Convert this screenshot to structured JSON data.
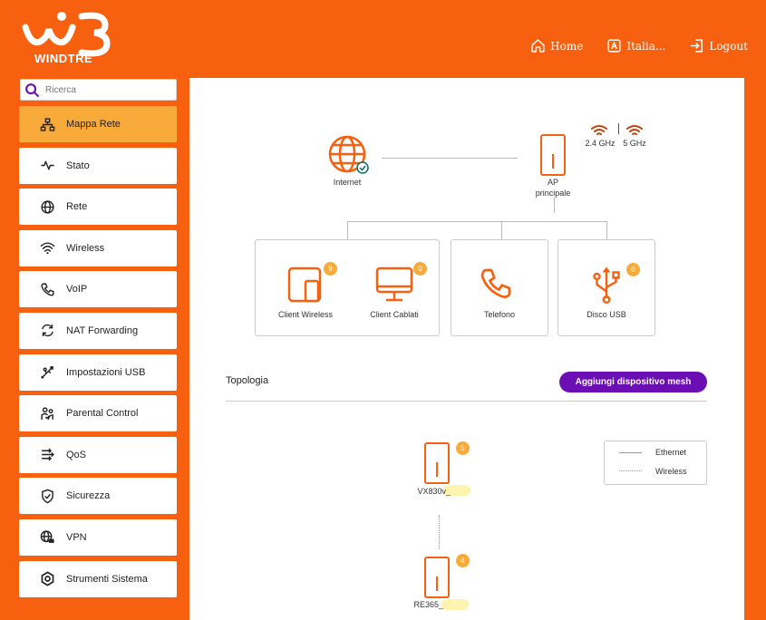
{
  "brand": {
    "name": "WINDTRE",
    "color": "#f6600f",
    "accent": "#f8aa3b",
    "purple": "#6b0fb4"
  },
  "topnav": [
    {
      "label": "Home",
      "icon": "home-icon"
    },
    {
      "label": "Italia...",
      "icon": "language-icon"
    },
    {
      "label": "Logout",
      "icon": "logout-icon"
    }
  ],
  "search": {
    "placeholder": "Ricerca"
  },
  "sidebar": {
    "items": [
      {
        "label": "Mappa Rete",
        "icon": "network-map-icon",
        "active": true
      },
      {
        "label": "Stato",
        "icon": "pulse-icon"
      },
      {
        "label": "Rete",
        "icon": "globe-icon"
      },
      {
        "label": "Wireless",
        "icon": "wifi-icon"
      },
      {
        "label": "VoIP",
        "icon": "phone-icon"
      },
      {
        "label": "NAT Forwarding",
        "icon": "refresh-icon"
      },
      {
        "label": "Impostazioni USB",
        "icon": "usb-icon"
      },
      {
        "label": "Parental Control",
        "icon": "family-icon"
      },
      {
        "label": "QoS",
        "icon": "qos-icon"
      },
      {
        "label": "Sicurezza",
        "icon": "shield-icon"
      },
      {
        "label": "VPN",
        "icon": "vpn-icon"
      },
      {
        "label": "Strumenti Sistema",
        "icon": "tools-icon"
      }
    ]
  },
  "map": {
    "internet_label": "Internet",
    "ap_label_1": "AP",
    "ap_label_2": "principale",
    "band_24": "2.4 GHz",
    "band_5": "5 GHz",
    "client_wireless": {
      "label": "Client Wireless",
      "count": "9"
    },
    "client_wired": {
      "label": "Client Cablati",
      "count": "0"
    },
    "phone": {
      "label": "Telefono"
    },
    "usb": {
      "label": "Disco USB",
      "count": "0"
    }
  },
  "topology": {
    "title": "Topologia",
    "add_mesh_label": "Aggiungi dispositivo mesh",
    "legend_ethernet": "Ethernet",
    "legend_wireless": "Wireless",
    "node1": {
      "name": "VX830v_",
      "count": "5"
    },
    "node2": {
      "name": "RE365_",
      "count": "4"
    }
  }
}
